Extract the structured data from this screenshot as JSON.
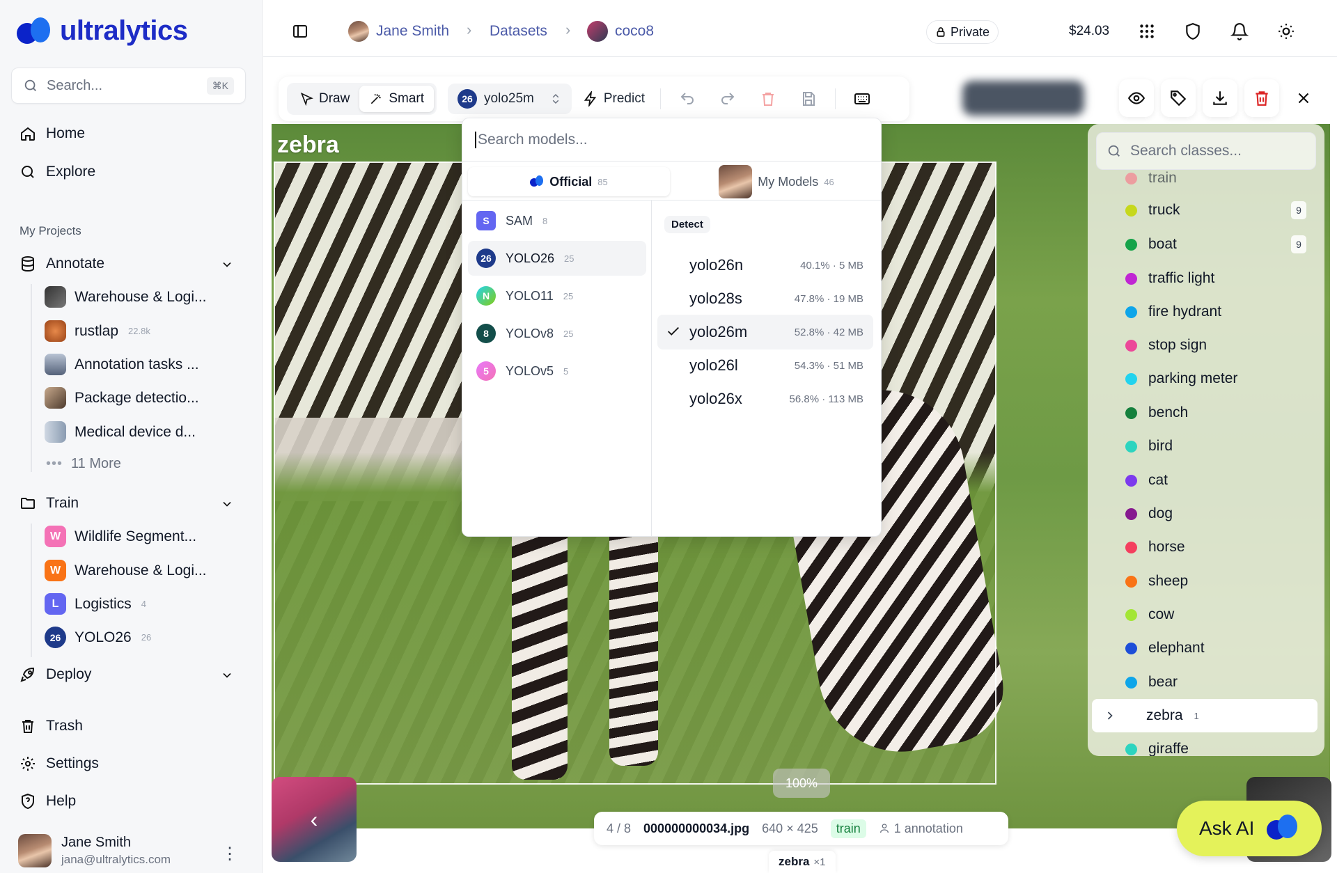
{
  "app": {
    "brand": "ultralytics"
  },
  "sidebar": {
    "search_placeholder": "Search...",
    "search_shortcut": "⌘K",
    "nav": {
      "home": "Home",
      "explore": "Explore"
    },
    "my_projects_label": "My Projects",
    "annotate": {
      "label": "Annotate",
      "items": [
        {
          "label": "Warehouse & Logi...",
          "count": ""
        },
        {
          "label": "rustlap",
          "count": "22.8k"
        },
        {
          "label": "Annotation tasks ...",
          "count": ""
        },
        {
          "label": "Package detectio...",
          "count": ""
        },
        {
          "label": "Medical device d...",
          "count": ""
        }
      ],
      "more": "11 More"
    },
    "train": {
      "label": "Train",
      "items": [
        {
          "badge": "W",
          "label": "Wildlife Segment...",
          "count": "",
          "color": "#f472b6"
        },
        {
          "badge": "W",
          "label": "Warehouse & Logi...",
          "count": "",
          "color": "#f97316"
        },
        {
          "badge": "L",
          "label": "Logistics",
          "count": "4",
          "color": "#6366f1"
        },
        {
          "badge": "26",
          "label": "YOLO26",
          "count": "26",
          "color": "#1e3a8a"
        }
      ]
    },
    "deploy": "Deploy",
    "trash": "Trash",
    "settings": "Settings",
    "help": "Help",
    "user": {
      "name": "Jane Smith",
      "email": "jana@ultralytics.com"
    }
  },
  "topbar": {
    "user": "Jane Smith",
    "datasets": "Datasets",
    "dataset": "coco8",
    "visibility": "Private",
    "balance": "$24.03",
    "icons": [
      "apps-grid-icon",
      "shield-icon",
      "bell-icon",
      "sun-icon"
    ]
  },
  "toolbar": {
    "draw": "Draw",
    "smart": "Smart",
    "model_badge": "26",
    "model": "yolo25m",
    "predict": "Predict"
  },
  "dropdown": {
    "search_placeholder": "Search models...",
    "tabs": [
      {
        "label": "Official",
        "count": "85"
      },
      {
        "label": "My Models",
        "count": "46"
      }
    ],
    "families": [
      {
        "badge": "S",
        "label": "SAM",
        "count": "8",
        "color": "#6366f1"
      },
      {
        "badge": "26",
        "label": "YOLO26",
        "count": "25",
        "color": "#1e3a8a"
      },
      {
        "badge": "N",
        "label": "YOLO11",
        "count": "25",
        "color": "#14b8a6"
      },
      {
        "badge": "8",
        "label": "YOLOv8",
        "count": "25",
        "color": "#134e4a"
      },
      {
        "badge": "5",
        "label": "YOLOv5",
        "count": "5",
        "color": "#e879f9"
      }
    ],
    "task": "Detect",
    "models": [
      {
        "name": "yolo26n",
        "meta": "40.1% · 5 MB"
      },
      {
        "name": "yolo28s",
        "meta": "47.8% · 19 MB"
      },
      {
        "name": "yolo26m",
        "meta": "52.8% · 42 MB"
      },
      {
        "name": "yolo26l",
        "meta": "54.3% · 51 MB"
      },
      {
        "name": "yolo26x",
        "meta": "56.8% · 113 MB"
      }
    ],
    "selected_model": "yolo26m"
  },
  "annotation": {
    "label": "zebra"
  },
  "classes": {
    "search_placeholder": "Search classes...",
    "items": [
      {
        "name": "truck",
        "color": "#c6d81c",
        "count": "9"
      },
      {
        "name": "boat",
        "color": "#16a34a",
        "count": "9"
      },
      {
        "name": "traffic light",
        "color": "#c026d3",
        "count": ""
      },
      {
        "name": "fire hydrant",
        "color": "#0ea5e9",
        "count": ""
      },
      {
        "name": "stop sign",
        "color": "#ec4899",
        "count": ""
      },
      {
        "name": "parking meter",
        "color": "#22d3ee",
        "count": ""
      },
      {
        "name": "bench",
        "color": "#15803d",
        "count": ""
      },
      {
        "name": "bird",
        "color": "#2dd4bf",
        "count": ""
      },
      {
        "name": "cat",
        "color": "#7c3aed",
        "count": ""
      },
      {
        "name": "dog",
        "color": "#86198f",
        "count": ""
      },
      {
        "name": "horse",
        "color": "#f43f5e",
        "count": ""
      },
      {
        "name": "sheep",
        "color": "#f97316",
        "count": ""
      },
      {
        "name": "cow",
        "color": "#a3e635",
        "count": ""
      },
      {
        "name": "elephant",
        "color": "#1d4ed8",
        "count": ""
      },
      {
        "name": "bear",
        "color": "#0ea5e9",
        "count": ""
      }
    ],
    "selected": {
      "name": "zebra",
      "count": "1"
    },
    "partial_top": "train",
    "partial_bottom": "giraffe"
  },
  "viewer": {
    "zoom": "100%",
    "position": "4 / 8",
    "filename": "000000000034.jpg",
    "dimensions": "640 × 425",
    "split": "train",
    "annotations": "1 annotation",
    "chip_label": "zebra",
    "chip_count": "×1"
  },
  "ask_ai": "Ask AI"
}
